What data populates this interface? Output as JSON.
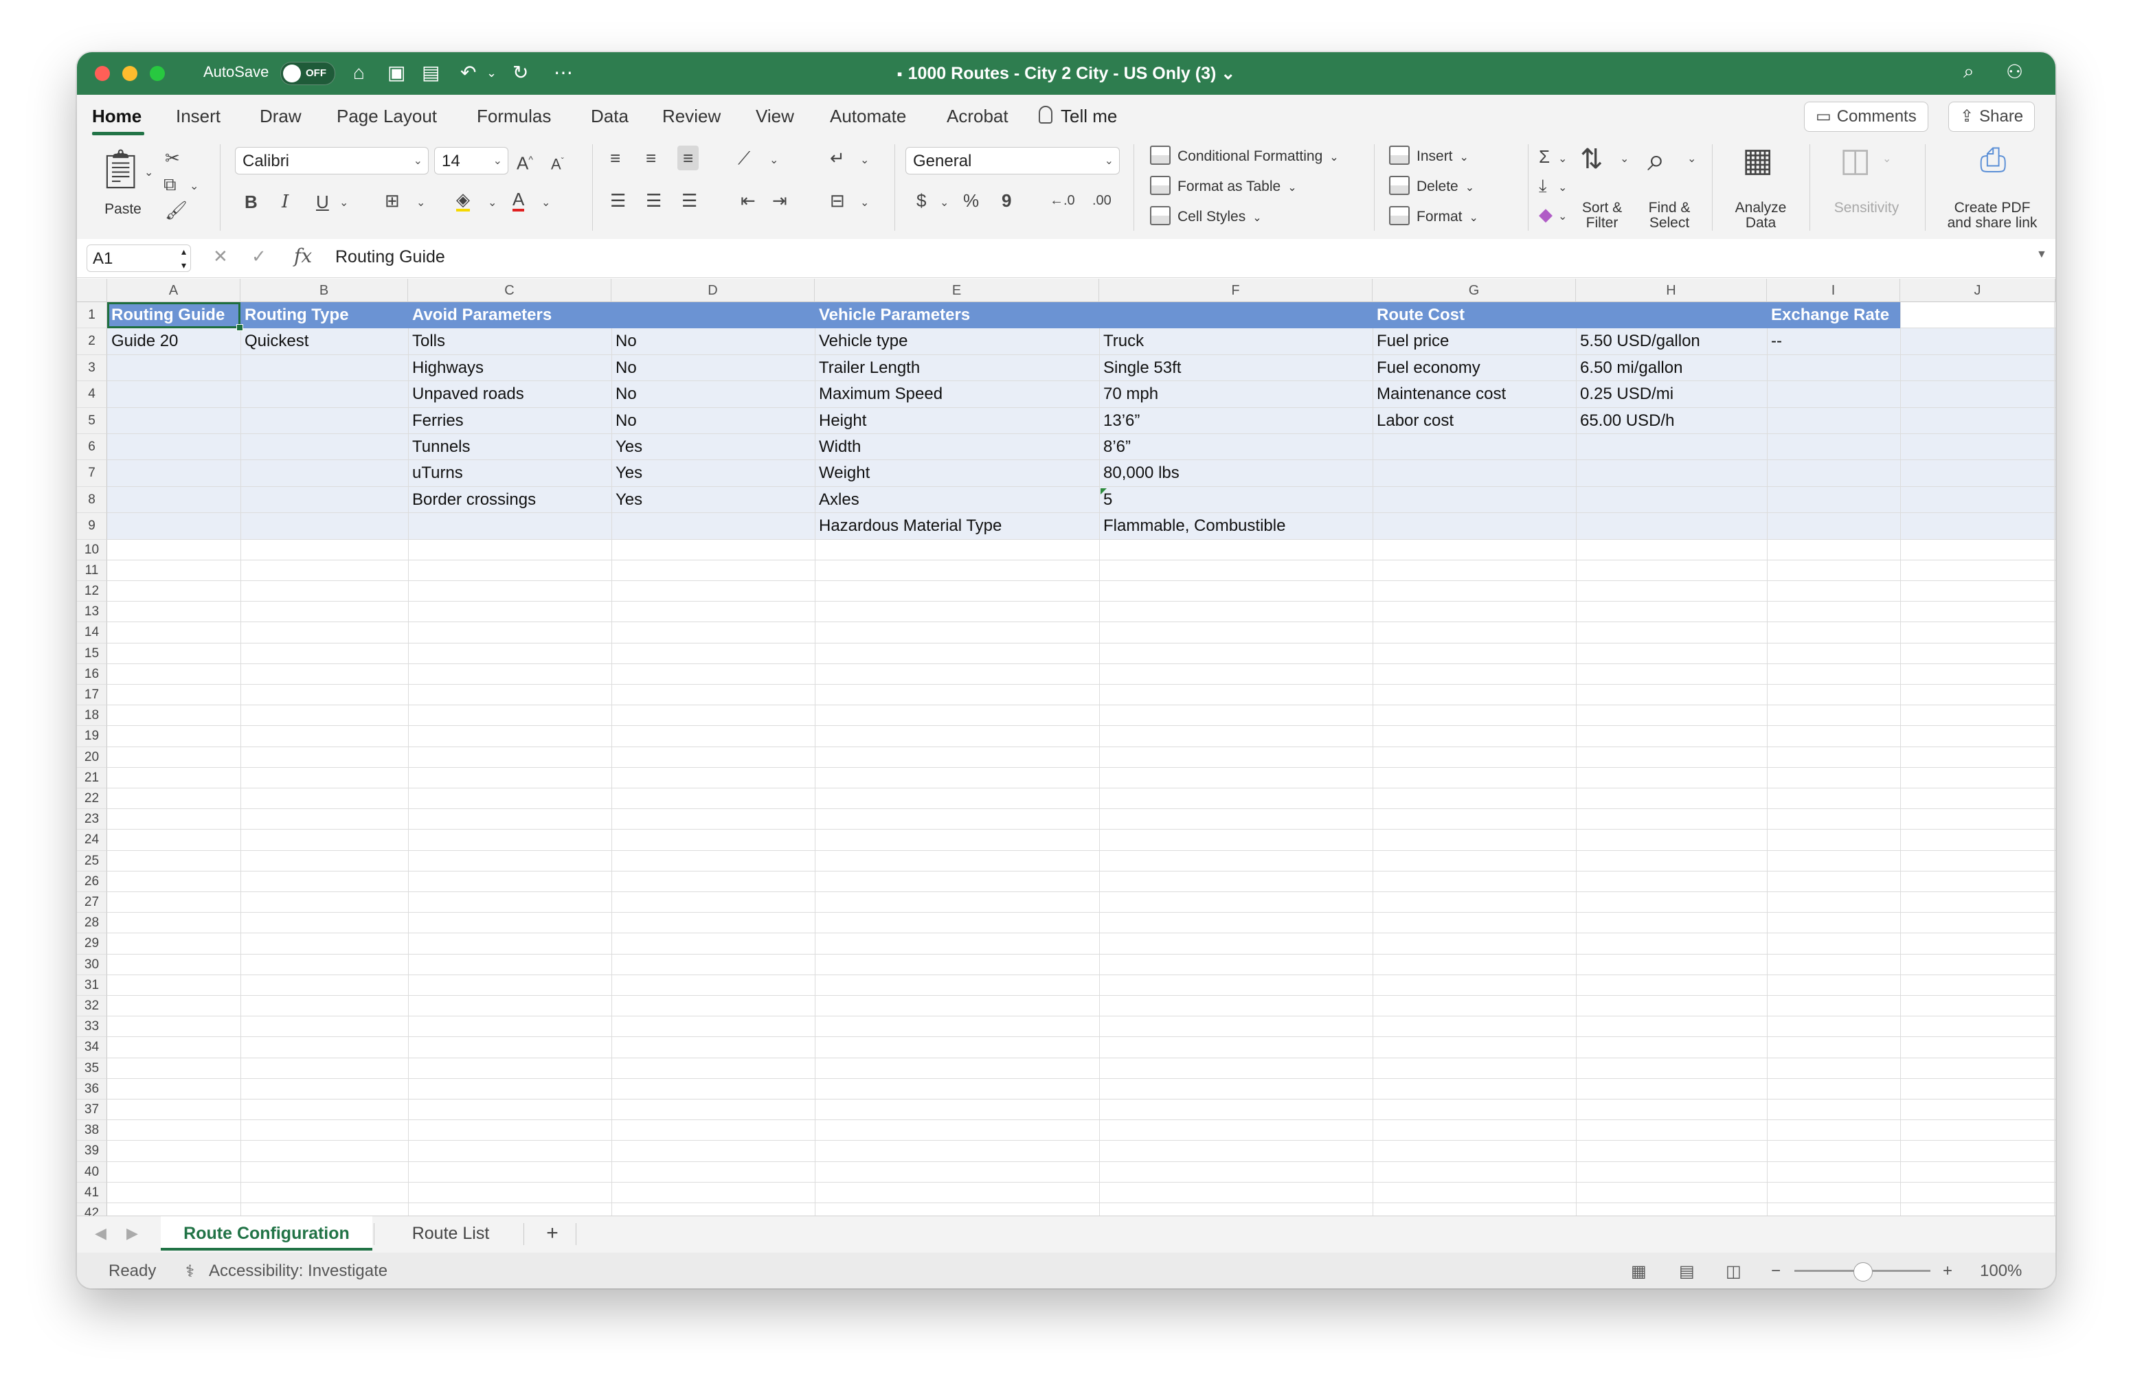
{
  "titlebar": {
    "autosave_label": "AutoSave",
    "autosave_state": "OFF",
    "doc_title": "1000 Routes - City 2 City - US Only (3) ⌄"
  },
  "ribbon_tabs": [
    "Home",
    "Insert",
    "Draw",
    "Page Layout",
    "Formulas",
    "Data",
    "Review",
    "View",
    "Automate",
    "Acrobat"
  ],
  "tell_me": "Tell me",
  "buttons": {
    "comments": "Comments",
    "share": "Share"
  },
  "ribbon": {
    "paste": "Paste",
    "font_name": "Calibri",
    "font_size": "14",
    "number_format": "General",
    "conditional_formatting": "Conditional Formatting",
    "format_as_table": "Format as Table",
    "cell_styles": "Cell Styles",
    "insert": "Insert",
    "delete": "Delete",
    "format": "Format",
    "sort_filter": [
      "Sort &",
      "Filter"
    ],
    "find_select": [
      "Find &",
      "Select"
    ],
    "analyze_data": [
      "Analyze",
      "Data"
    ],
    "sensitivity": "Sensitivity",
    "create_pdf": [
      "Create PDF",
      "and share link"
    ]
  },
  "formula_bar": {
    "name_box": "A1",
    "value": "Routing Guide"
  },
  "columns": [
    "A",
    "B",
    "C",
    "D",
    "E",
    "F",
    "G",
    "H",
    "I",
    "J"
  ],
  "row_numbers": [
    "1",
    "2",
    "3",
    "4",
    "5",
    "6",
    "7",
    "8",
    "9",
    "10",
    "11",
    "12",
    "13",
    "14",
    "15",
    "16",
    "17",
    "18",
    "19",
    "20",
    "21",
    "22",
    "23",
    "24",
    "25",
    "26",
    "27",
    "28",
    "29",
    "30",
    "31",
    "32",
    "33",
    "34",
    "35",
    "36",
    "37",
    "38",
    "39",
    "40",
    "41",
    "42"
  ],
  "header_row": {
    "A": "Routing Guide",
    "B": "Routing Type",
    "C": "Avoid Parameters",
    "E": "Vehicle Parameters",
    "G": "Route Cost",
    "I": "Exchange Rate"
  },
  "data_rows": [
    {
      "A": "Guide 20",
      "B": "Quickest",
      "C": "Tolls",
      "D": "No",
      "E": "Vehicle type",
      "F": "Truck",
      "G": "Fuel price",
      "H": "5.50 USD/gallon",
      "I": "--"
    },
    {
      "A": "",
      "B": "",
      "C": "Highways",
      "D": "No",
      "E": "Trailer Length",
      "F": "Single 53ft",
      "G": "Fuel economy",
      "H": "6.50 mi/gallon",
      "I": ""
    },
    {
      "A": "",
      "B": "",
      "C": "Unpaved roads",
      "D": "No",
      "E": "Maximum Speed",
      "F": "70 mph",
      "G": "Maintenance cost",
      "H": "0.25 USD/mi",
      "I": ""
    },
    {
      "A": "",
      "B": "",
      "C": "Ferries",
      "D": "No",
      "E": "Height",
      "F": "13’6”",
      "G": "Labor cost",
      "H": "65.00 USD/h",
      "I": ""
    },
    {
      "A": "",
      "B": "",
      "C": "Tunnels",
      "D": "Yes",
      "E": "Width",
      "F": "8’6”",
      "G": "",
      "H": "",
      "I": ""
    },
    {
      "A": "",
      "B": "",
      "C": "uTurns",
      "D": "Yes",
      "E": "Weight",
      "F": "80,000 lbs",
      "G": "",
      "H": "",
      "I": ""
    },
    {
      "A": "",
      "B": "",
      "C": "Border crossings",
      "D": "Yes",
      "E": "Axles",
      "F": "5",
      "G": "",
      "H": "",
      "I": ""
    },
    {
      "A": "",
      "B": "",
      "C": "",
      "D": "",
      "E": "Hazardous Material Type",
      "F": "Flammable, Combustible",
      "G": "",
      "H": "",
      "I": ""
    }
  ],
  "sheet_tabs": [
    "Route Configuration",
    "Route List"
  ],
  "status": {
    "ready": "Ready",
    "accessibility": "Accessibility: Investigate",
    "zoom": "100%"
  },
  "colors": {
    "titlebar": "#2e7d4f",
    "accent": "#217346",
    "header_fill": "#6b93d3",
    "band_fill": "#e9eef7"
  }
}
